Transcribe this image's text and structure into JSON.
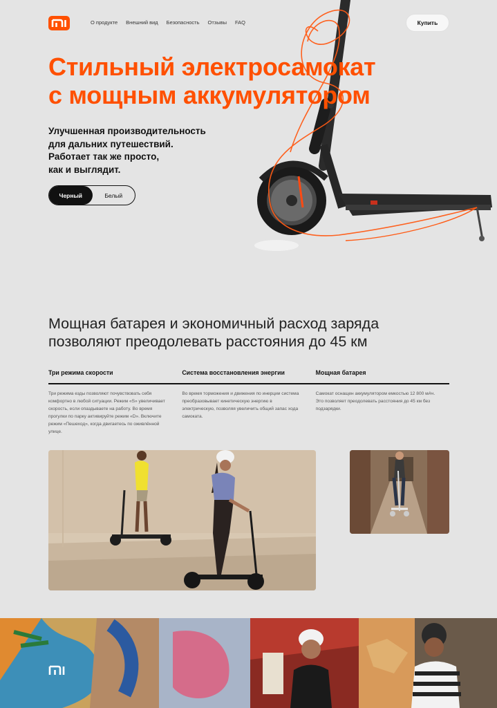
{
  "header": {
    "nav": [
      "О продукте",
      "Внешний вид",
      "Безопасность",
      "Отзывы",
      "FAQ"
    ],
    "buy_label": "Купить"
  },
  "hero": {
    "title_lines": [
      "Стильный электросамокат",
      "с мощным аккумулятором"
    ],
    "subtitle_lines": [
      "Улучшенная производительность",
      "для дальних путешествий.",
      "Работает так же просто,",
      "как и выглядит."
    ],
    "color_options": [
      "Черный",
      "Белый"
    ],
    "selected_color": "Черный"
  },
  "section": {
    "title_lines": [
      "Мощная батарея и экономичный расход заряда",
      "позволяют преодолевать расстояния до 45 км"
    ],
    "features": [
      {
        "title": "Три режима скорости",
        "text": "Три режима езды позволяют почувствовать себя комфортно в любой ситуации. Режим «S» увеличивает скорость, если опаздываете на работу. Во время прогулки по парку активируйте режим «D». Включите режим «Пешеход», когда двигаетесь по оживлённой улице."
      },
      {
        "title": "Система восстановления энергии",
        "text": "Во время торможения и движения по инерции система преобразовывает кинетическую энергию в электрическую, позволяя увеличить общий запас хода самоката."
      },
      {
        "title": "Мощная батарея",
        "text": "Самокат оснащен аккумулятором емкостью 12 800 мАч. Это позволяет преодолевать расстояния до 45 км без подзарядки."
      }
    ]
  },
  "colors": {
    "accent": "#ff5000",
    "background": "#e4e4e4",
    "text": "#111111"
  },
  "icons": [
    "mi-logo-icon"
  ]
}
